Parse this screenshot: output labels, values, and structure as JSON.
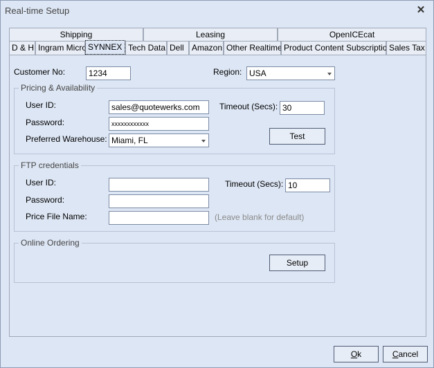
{
  "window": {
    "title": "Real-time Setup"
  },
  "tabs_row1": [
    {
      "label": "Shipping"
    },
    {
      "label": "Leasing"
    },
    {
      "label": "OpenICEcat"
    }
  ],
  "tabs_row2": [
    {
      "label": "D & H"
    },
    {
      "label": "Ingram Micro"
    },
    {
      "label": "SYNNEX",
      "active": true
    },
    {
      "label": "Tech Data"
    },
    {
      "label": "Dell"
    },
    {
      "label": "Amazon"
    },
    {
      "label": "Other Realtime"
    },
    {
      "label": "Product Content Subscription"
    },
    {
      "label": "Sales Tax"
    }
  ],
  "customer": {
    "label": "Customer No:",
    "value": "1234"
  },
  "region": {
    "label": "Region:",
    "value": "USA"
  },
  "pricing": {
    "title": "Pricing & Availability",
    "user_id_label": "User ID:",
    "user_id_value": "sales@quotewerks.com",
    "password_label": "Password:",
    "password_value": "xxxxxxxxxxxx",
    "warehouse_label": "Preferred Warehouse:",
    "warehouse_value": "Miami, FL",
    "timeout_label": "Timeout (Secs):",
    "timeout_value": "30",
    "test_button": "Test"
  },
  "ftp": {
    "title": "FTP credentials",
    "user_id_label": "User ID:",
    "user_id_value": "",
    "password_label": "Password:",
    "password_value": "",
    "price_file_label": "Price File Name:",
    "price_file_value": "",
    "price_file_hint": "(Leave blank for default)",
    "timeout_label": "Timeout (Secs):",
    "timeout_value": "10"
  },
  "ordering": {
    "title": "Online Ordering",
    "setup_button": "Setup"
  },
  "footer": {
    "ok_mnemonic": "O",
    "ok_rest": "k",
    "cancel_mnemonic": "C",
    "cancel_rest": "ancel"
  }
}
